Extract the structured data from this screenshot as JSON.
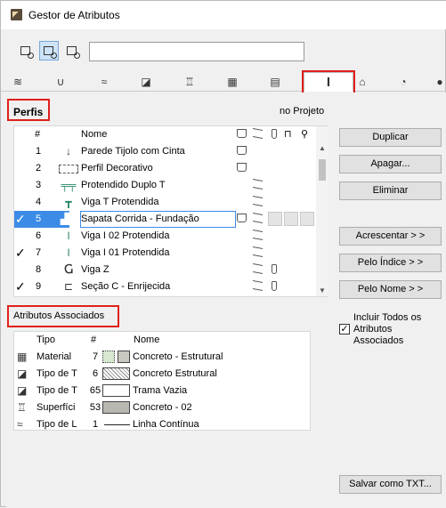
{
  "window": {
    "title": "Gestor de Atributos"
  },
  "search": {
    "value": "",
    "placeholder": ""
  },
  "tabs": [
    "layers-icon",
    "pen-icon",
    "line-type-icon",
    "fill-icon",
    "surface-icon",
    "building-material-icon",
    "composite-icon",
    "profile-icon",
    "zone-icon",
    "mep-icon",
    "globe-icon"
  ],
  "profiles": {
    "section_label": "Perfis",
    "filter_label": "no Projeto",
    "columns": {
      "num": "#",
      "name": "Nome"
    },
    "rows": [
      {
        "checked": false,
        "num": "1",
        "name": "Parede Tijolo com Cinta",
        "selected": false
      },
      {
        "checked": false,
        "num": "2",
        "name": "Perfil Decorativo",
        "selected": false
      },
      {
        "checked": false,
        "num": "3",
        "name": "Protendido Duplo T",
        "selected": false
      },
      {
        "checked": false,
        "num": "4",
        "name": "Viga T Protendida",
        "selected": false
      },
      {
        "checked": true,
        "num": "5",
        "name": "Sapata Corrida - Fundação",
        "selected": true
      },
      {
        "checked": false,
        "num": "6",
        "name": "Viga I 02 Protendida",
        "selected": false
      },
      {
        "checked": true,
        "num": "7",
        "name": "Viga I 01 Protendida",
        "selected": false
      },
      {
        "checked": false,
        "num": "8",
        "name": "Viga Z",
        "selected": false
      },
      {
        "checked": true,
        "num": "9",
        "name": "Seção C - Enrijecida",
        "selected": false
      }
    ]
  },
  "associated": {
    "section_label": "Atributos Associados",
    "columns": {
      "type": "Tipo",
      "num": "#",
      "name": "Nome"
    },
    "rows": [
      {
        "type": "Material",
        "num": "7",
        "name": "Concreto - Estrutural",
        "swatch": "#d8e8d0"
      },
      {
        "type": "Tipo de T",
        "num": "6",
        "name": "Concreto Estrutural",
        "swatch": "#ffffff"
      },
      {
        "type": "Tipo de T",
        "num": "65",
        "name": "Trama Vazia",
        "swatch": "#ffffff"
      },
      {
        "type": "Superfíci",
        "num": "53",
        "name": "Concreto - 02",
        "swatch": "#b8b8b0"
      },
      {
        "type": "Tipo de L",
        "num": "1",
        "name": "Linha Contínua",
        "swatch": "line"
      }
    ]
  },
  "buttons": {
    "duplicate": "Duplicar",
    "delete": "Apagar...",
    "remove": "Eliminar",
    "append": "Acrescentar > >",
    "by_index": "Pelo Índice > >",
    "by_name": "Pelo Nome > >",
    "save_txt": "Salvar como TXT..."
  },
  "options": {
    "include_all_label": "Incluir Todos os Atributos Associados",
    "include_all_checked": true
  },
  "checkmark": "✓"
}
